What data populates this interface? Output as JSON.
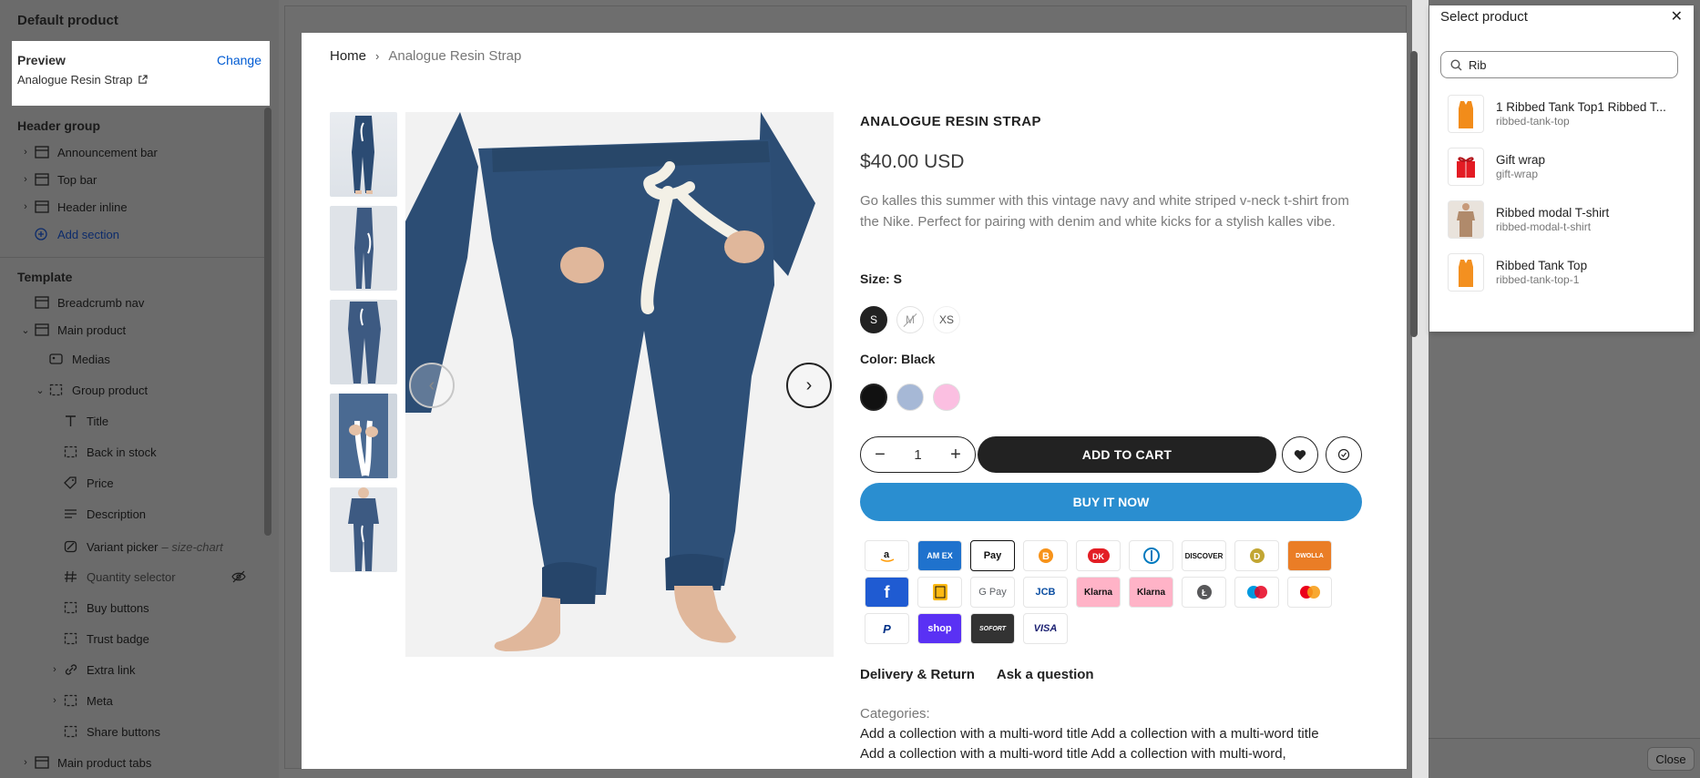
{
  "sidebar": {
    "title": "Default product",
    "preview": {
      "label": "Preview",
      "change": "Change",
      "product": "Analogue Resin Strap"
    },
    "header_group": {
      "title": "Header group",
      "items": [
        "Announcement bar",
        "Top bar",
        "Header inline"
      ],
      "add_section": "Add section"
    },
    "template": {
      "title": "Template",
      "breadcrumb": "Breadcrumb nav",
      "main_product": "Main product",
      "medias": "Medias",
      "group_product": "Group product",
      "blocks": [
        "Title",
        "Back in stock",
        "Price",
        "Description"
      ],
      "variant_picker": "Variant picker",
      "variant_note": "– size-chart",
      "quantity_selector": "Quantity selector",
      "buy_buttons": "Buy buttons",
      "trust_badge": "Trust badge",
      "extra_link": "Extra link",
      "meta": "Meta",
      "share_buttons": "Share buttons",
      "main_product_tabs": "Main product tabs"
    }
  },
  "breadcrumb": {
    "home": "Home",
    "current": "Analogue Resin Strap"
  },
  "product": {
    "title": "ANALOGUE RESIN STRAP",
    "price": "$40.00 USD",
    "description": "Go kalles this summer with this vintage navy and white striped v-neck t-shirt from the Nike. Perfect for pairing with denim and white kicks for a stylish kalles vibe.",
    "size_label": "Size:",
    "size_value": "S",
    "sizes": [
      "S",
      "M",
      "XS"
    ],
    "color_label": "Color:",
    "color_value": "Black",
    "colors": [
      "#111111",
      "#a6b8d6",
      "#fbbfe1"
    ],
    "quantity": "1",
    "add_to_cart": "ADD TO CART",
    "buy_now": "BUY IT NOW",
    "tabs": [
      "Delivery & Return",
      "Ask a question"
    ],
    "categories_label": "Categories:",
    "categories_lines": [
      "Add a collection with a multi-word title Add a collection with a multi-word title",
      "Add a collection with a multi-word title Add a collection with multi-word,"
    ]
  },
  "payment_icons": [
    "amazon-pay",
    "american-express",
    "apple-pay",
    "bitcoin",
    "dankort",
    "diners-club",
    "discover",
    "dogecoin",
    "dwolla",
    "forbrugsforeningen",
    "interac",
    "google-pay",
    "jcb",
    "klarna-pay-later",
    "klarna",
    "litecoin",
    "maestro",
    "mastercard",
    "paypal",
    "shop-pay",
    "sofort",
    "visa"
  ],
  "payment_labels": {
    "american-express": "AM EX",
    "apple-pay": "Pay",
    "google-pay": "G Pay",
    "jcb": "JCB",
    "klarna-pay-later": "Klarna",
    "klarna": "Klarna",
    "discover": "DISCOVER",
    "dwolla": "DWOLLA",
    "shop-pay": "shop",
    "sofort": "SOFORT",
    "visa": "VISA"
  },
  "select_product": {
    "title": "Select product",
    "search_value": "Rib",
    "results": [
      {
        "title": "1 Ribbed Tank Top1 Ribbed T...",
        "handle": "ribbed-tank-top"
      },
      {
        "title": "Gift wrap",
        "handle": "gift-wrap"
      },
      {
        "title": "Ribbed modal T-shirt",
        "handle": "ribbed-modal-t-shirt"
      },
      {
        "title": "Ribbed Tank Top",
        "handle": "ribbed-tank-top-1"
      }
    ],
    "close": "Close"
  },
  "colors": {
    "accent": "#005bd3",
    "buy_now": "#2a8ed0",
    "dark_button": "#222222"
  }
}
